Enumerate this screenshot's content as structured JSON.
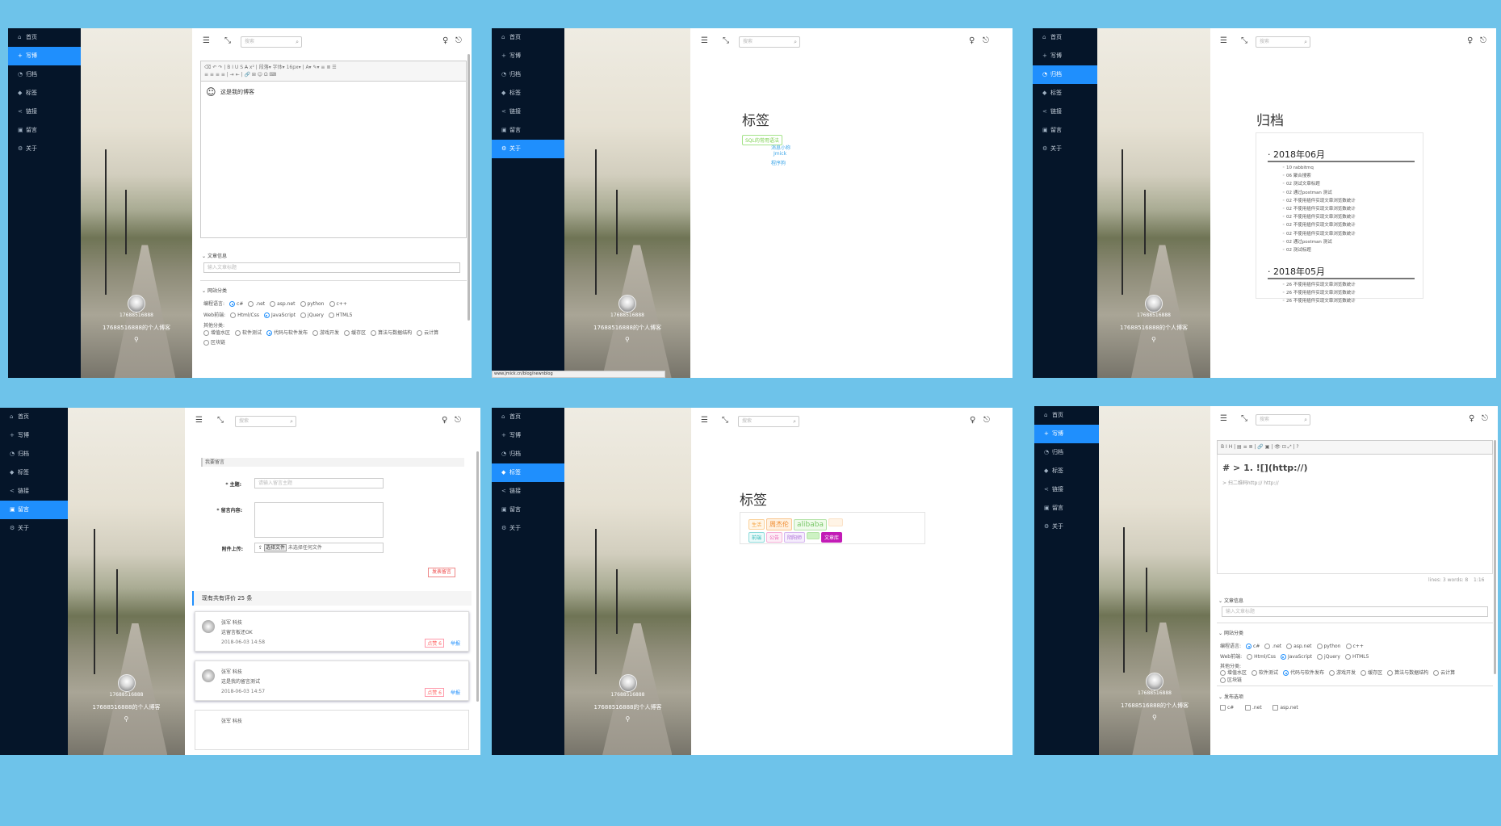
{
  "colors": {
    "background": "#6ec3ea",
    "sidebar": "#051529",
    "active": "#1f8ffd"
  },
  "nav": {
    "home": "首页",
    "write": "写博",
    "archive": "归档",
    "tags": "标签",
    "links": "链接",
    "message": "留言",
    "about": "关于"
  },
  "hero": {
    "qq": "17688516888",
    "motto": "17688516888的个人博客"
  },
  "search_placeholder": "搜索",
  "p1": {
    "editor_text": "这是我的博客",
    "article_section": "文章信息",
    "title_placeholder": "输入文章标题",
    "category_section": "网站分类",
    "lang_label": "编程语言:",
    "langs": [
      "c#",
      ".net",
      "asp.net",
      "python",
      "c++"
    ],
    "web_label": "Web前端:",
    "webs": [
      "Html/Css",
      "JavaScript",
      "jQuery",
      "HTML5"
    ],
    "other_label": "其他分类:",
    "others": [
      "增值水区",
      "软件测试",
      "代码与软件发布",
      "游戏开发",
      "缓存区",
      "算法与数据结构",
      "云计算",
      "区块链"
    ],
    "fmt": "段落",
    "font": "字体",
    "size": "16px"
  },
  "p2": {
    "title": "标签",
    "tags": [
      "SQL的常用语法",
      "消息小称",
      "Jmick",
      "程序狗"
    ],
    "status": "www.jmick.cn/blog/newnblog"
  },
  "p3": {
    "title": "归档",
    "months": [
      {
        "label": "2018年06月",
        "items": [
          "10 rabbitmq",
          "06 聚合搜索",
          "02 测试文章标题",
          "02 通过postman 测试",
          "02 不使用插件实现文章浏览数统计",
          "02 不使用插件实现文章浏览数统计",
          "02 不使用插件实现文章浏览数统计",
          "02 不使用插件实现文章浏览数统计",
          "02 不使用插件实现文章浏览数统计",
          "02 通过postman 测试",
          "02 测试标题"
        ]
      },
      {
        "label": "2018年05月",
        "items": [
          "26 不使用插件实现文章浏览数统计",
          "26 不使用插件实现文章浏览数统计",
          "26 不使用插件实现文章浏览数统计"
        ]
      }
    ]
  },
  "p4": {
    "section": "我要留言",
    "subject_label": "* 主题:",
    "subject_placeholder": "请输入留言主题",
    "content_label": "* 留言内容:",
    "upload_label": "附件上传:",
    "choose_file": "选择文件",
    "no_file": "未选择任何文件",
    "submit": "发表留言",
    "count": "现有共有评价 25 条",
    "comments": [
      {
        "user": "张军 科技",
        "text": "这留言板还OK",
        "time": "2018-06-03 14:58",
        "like": "点赞 6",
        "reply": "举报"
      },
      {
        "user": "张军 科技",
        "text": "这是我的留言测试",
        "time": "2018-06-03 14:57",
        "like": "点赞 6",
        "reply": "举报"
      },
      {
        "user": "张军 科技",
        "text": "",
        "time": "",
        "like": "",
        "reply": ""
      }
    ]
  },
  "p5": {
    "title": "标签",
    "tags_row1": [
      "生活",
      "周杰伦",
      "alibaba",
      ""
    ],
    "tags_row2": [
      "前端",
      "公告",
      "阴阳师",
      "",
      "文章库"
    ]
  },
  "p6": {
    "heading": "# > 1. ![](http://)",
    "line2": "> 扫二维码http://  http://",
    "status": "lines: 3 words: 8",
    "status2": "1:16",
    "article_section": "文章信息",
    "title_placeholder": "输入文章标题",
    "category_section": "网站分类",
    "publish_section": "发布选项",
    "publish_opts": [
      "c#",
      ".net",
      "asp.net"
    ]
  }
}
